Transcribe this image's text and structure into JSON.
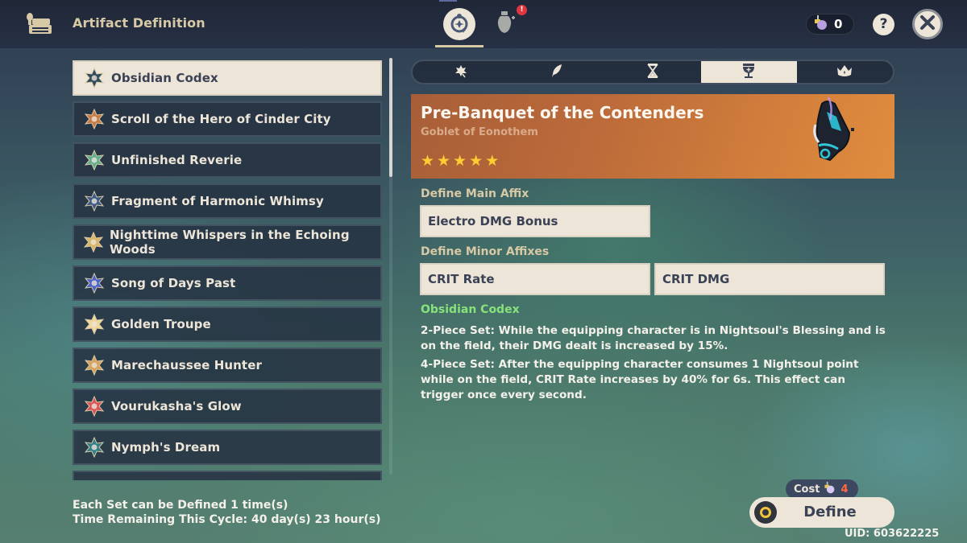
{
  "header": {
    "title": "Artifact Definition",
    "app_icon": "artifact-definition-icon",
    "mode_tabs": [
      {
        "name": "artifact-strongbox-tab",
        "icon": "sparkle-medallion-icon",
        "active": true
      },
      {
        "name": "transmuter-tab",
        "icon": "vase-plus-icon",
        "active": false,
        "alert": "!"
      }
    ],
    "currency": {
      "icon": "sanctifying-elixir-icon",
      "value": "0"
    },
    "help_label": "?",
    "close_icon": "close-icon"
  },
  "set_list": {
    "selected_index": 0,
    "items": [
      {
        "label": "Obsidian Codex",
        "icon": "obsidian-codex-icon",
        "color": "#2f4a5c"
      },
      {
        "label": "Scroll of the Hero of Cinder City",
        "icon": "scroll-hero-icon",
        "color": "#c77a43"
      },
      {
        "label": "Unfinished Reverie",
        "icon": "unfinished-reverie-icon",
        "color": "#5fae8e"
      },
      {
        "label": "Fragment of Harmonic Whimsy",
        "icon": "harmonic-whimsy-icon",
        "color": "#3b5a88"
      },
      {
        "label": "Nighttime Whispers in the Echoing Woods",
        "icon": "nighttime-whispers-icon",
        "color": "#d7b66a"
      },
      {
        "label": "Song of Days Past",
        "icon": "song-days-past-icon",
        "color": "#4a64c8"
      },
      {
        "label": "Golden Troupe",
        "icon": "golden-troupe-icon",
        "color": "#f1d79c"
      },
      {
        "label": "Marechaussee Hunter",
        "icon": "marechaussee-hunter-icon",
        "color": "#d8a25a"
      },
      {
        "label": "Vourukasha's Glow",
        "icon": "vourukasha-glow-icon",
        "color": "#d9555a"
      },
      {
        "label": "Nymph's Dream",
        "icon": "nymph-dream-icon",
        "color": "#2f7f86"
      },
      {
        "label": "",
        "icon": "",
        "color": "#2f4050"
      }
    ]
  },
  "footer": {
    "line1": "Each Set can be Defined 1 time(s)",
    "line2": "Time Remaining This Cycle: 40 day(s) 23 hour(s)"
  },
  "piece_tabs": [
    {
      "name": "flower-of-life",
      "icon": "flower-icon",
      "active": false
    },
    {
      "name": "plume-of-death",
      "icon": "plume-icon",
      "active": false
    },
    {
      "name": "sands-of-eon",
      "icon": "hourglass-icon",
      "active": false
    },
    {
      "name": "goblet-of-eonothem",
      "icon": "goblet-icon",
      "active": true
    },
    {
      "name": "circlet-of-logos",
      "icon": "circlet-icon",
      "active": false
    }
  ],
  "artifact": {
    "name": "Pre-Banquet of the Contenders",
    "type": "Goblet of Eonothem",
    "rarity": 5,
    "star_glyph": "★"
  },
  "main_affix": {
    "label": "Define Main Affix",
    "value": "Electro DMG Bonus"
  },
  "minor_affixes": {
    "label": "Define Minor Affixes",
    "values": [
      "CRIT Rate",
      "CRIT DMG"
    ]
  },
  "set_bonus": {
    "name": "Obsidian Codex",
    "two_piece": "2-Piece Set: While the equipping character is in Nightsoul's Blessing and is on the field, their DMG dealt is increased by 15%.",
    "four_piece": "4-Piece Set: After the equipping character consumes 1 Nightsoul point while on the field, CRIT Rate increases by 40% for 6s. This effect can trigger once every second."
  },
  "action": {
    "cost_label": "Cost",
    "cost_icon": "sanctifying-elixir-icon",
    "cost_value": "4",
    "define_label": "Define",
    "define_icon": "controller-y-button-icon"
  },
  "uid": "UID: 603622225",
  "colors": {
    "accent_cream": "#ece5d8",
    "gold_label": "#d8c9a6",
    "set_green": "#88e27b",
    "cost_red": "#ff6840",
    "star_gold": "#ffcc33",
    "header_orange": "#d37f3c"
  }
}
